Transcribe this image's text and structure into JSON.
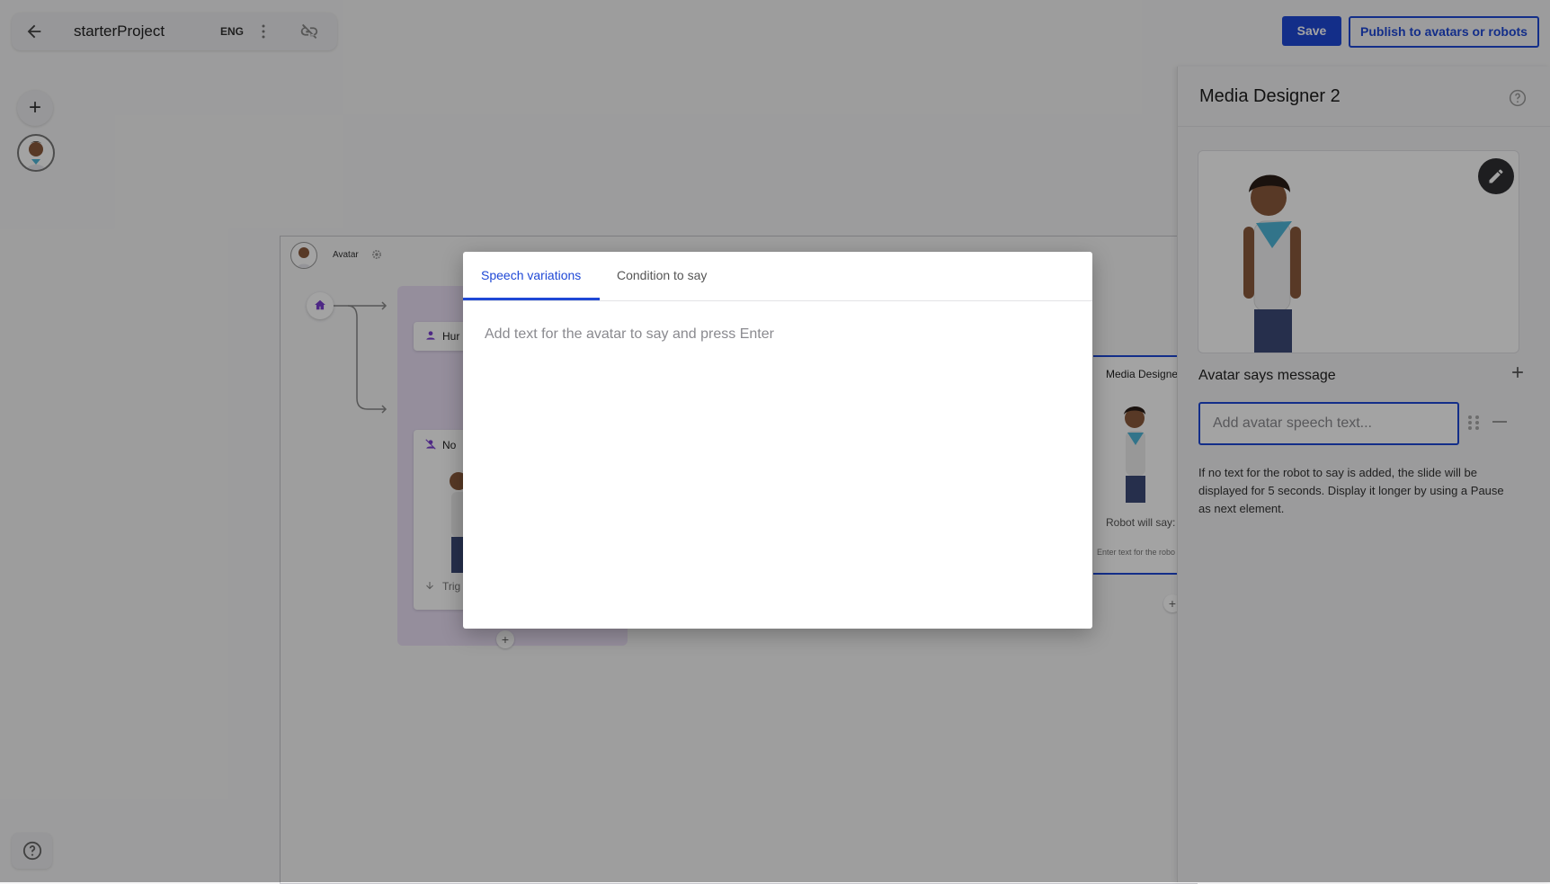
{
  "header": {
    "project_name": "starterProject",
    "language": "ENG",
    "save_label": "Save",
    "publish_label": "Publish to avatars or robots"
  },
  "canvas": {
    "avatar_label": "Avatar",
    "human_label": "Hur",
    "no_person_label": "No",
    "trigger_label": "Trig",
    "media_node": {
      "title": "Media Designe",
      "robot_says": "Robot will say:",
      "enter_text": "Enter text for the robo"
    }
  },
  "right_panel": {
    "title": "Media Designer 2",
    "says_label": "Avatar says message",
    "speech_placeholder": "Add avatar speech text...",
    "note": "If no text for the robot to say is added, the slide will be displayed for 5 seconds. Display it longer by using a Pause as next element."
  },
  "modal": {
    "tabs": [
      "Speech variations",
      "Condition to say"
    ],
    "active_tab": "Speech variations",
    "input_placeholder": "Add text for the avatar to say and press Enter"
  },
  "colors": {
    "accent": "#1f48d6",
    "group_bg": "#e9dff5",
    "overlay": "rgba(0,0,0,0.36)"
  },
  "icons": [
    "back-arrow-icon",
    "more-vert-icon",
    "link-off-icon",
    "plus-icon",
    "help-icon",
    "home-icon",
    "gear-icon",
    "person-icon",
    "person-off-icon",
    "edit-pencil-icon",
    "drag-handle-icon",
    "minus-icon"
  ]
}
